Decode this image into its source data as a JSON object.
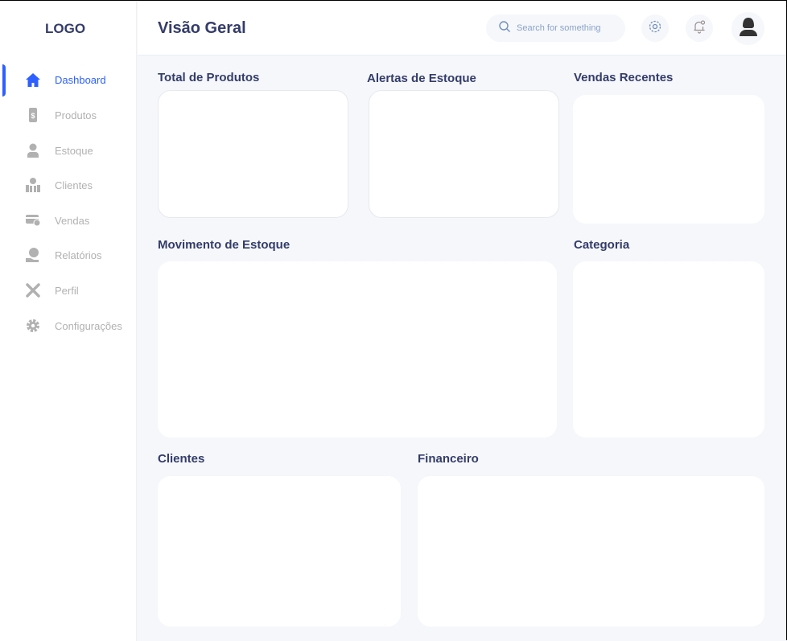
{
  "sidebar": {
    "logo": "LOGO",
    "items": [
      {
        "label": "Dashboard",
        "icon": "home-icon",
        "active": true
      },
      {
        "label": "Produtos",
        "icon": "money-transfer-icon"
      },
      {
        "label": "Estoque",
        "icon": "user-icon"
      },
      {
        "label": "Clientes",
        "icon": "investment-icon"
      },
      {
        "label": "Vendas",
        "icon": "credit-card-icon"
      },
      {
        "label": "Relatórios",
        "icon": "loan-icon"
      },
      {
        "label": "Perfil",
        "icon": "tools-icon"
      },
      {
        "label": "Configurações",
        "icon": "gear-icon"
      }
    ]
  },
  "header": {
    "title": "Visão Geral",
    "search_placeholder": "Search for something"
  },
  "sections": {
    "total_produtos": "Total de Produtos",
    "alertas": "Alertas de Estoque",
    "vendas": "Vendas Recentes",
    "movimento": "Movimento de Estoque",
    "categoria": "Categoria",
    "clientes": "Clientes",
    "financeiro": "Financeiro"
  },
  "colors": {
    "accent": "#2d60ff",
    "text": "#343c6a",
    "muted": "#b1b1b1",
    "background": "#f5f7fa"
  }
}
